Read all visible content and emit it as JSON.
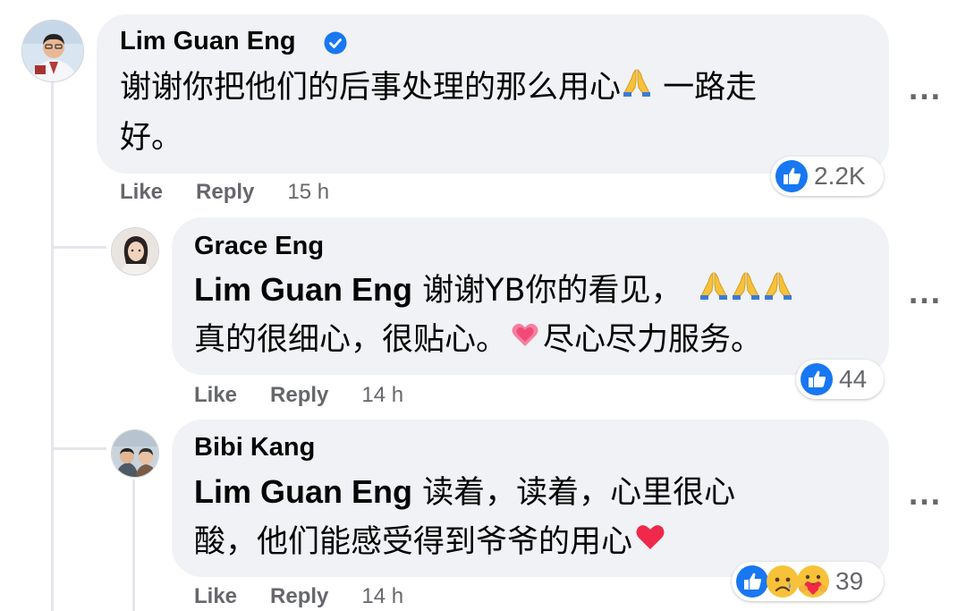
{
  "comments": [
    {
      "author": "Lim Guan Eng",
      "verified": true,
      "line1": "谢谢你把他们的后事处理的那么用心",
      "line1_after": " 一路走",
      "line2": "好。",
      "like": "Like",
      "reply": "Reply",
      "time": "15 h",
      "reaction_count": "2.2K",
      "reaction_icons": [
        "like-icon"
      ]
    },
    {
      "author": "Grace Eng",
      "mention": "Lim Guan Eng",
      "line1": " 谢谢YB你的看见，",
      "line2a": "真的很细心，很贴心。",
      "line2b": "尽心尽力服务。",
      "like": "Like",
      "reply": "Reply",
      "time": "14 h",
      "reaction_count": "44",
      "reaction_icons": [
        "like-icon"
      ]
    },
    {
      "author": "Bibi Kang",
      "mention": "Lim Guan Eng",
      "line1": " 读着，读着，心里很心",
      "line2": "酸，他们能感受得到爷爷的用心",
      "like": "Like",
      "reply": "Reply",
      "time": "14 h",
      "reaction_count": "39",
      "reaction_icons": [
        "like-icon",
        "sad-icon",
        "care-icon"
      ]
    }
  ],
  "more_label": "...",
  "colors": {
    "bubble": "#f0f2f5",
    "like_blue": "#1877f2",
    "secondary_text": "#65676b",
    "heart_red": "#f02849"
  }
}
